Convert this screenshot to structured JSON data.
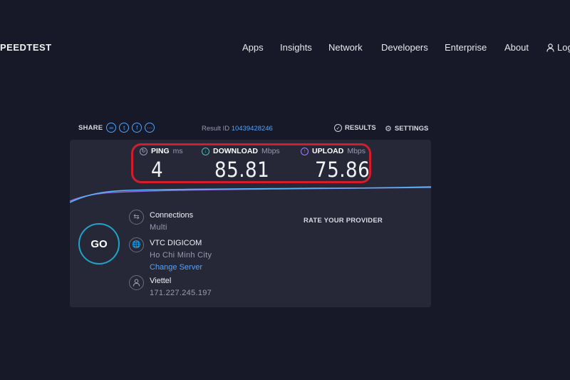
{
  "header": {
    "logo": "PEEDTEST",
    "nav": [
      "Apps",
      "Insights",
      "Network",
      "Developers",
      "Enterprise",
      "About"
    ],
    "login": "Log"
  },
  "toolbar": {
    "share_label": "SHARE",
    "result_id_label": "Result ID",
    "result_id": "10439428246",
    "results_label": "RESULTS",
    "settings_label": "SETTINGS"
  },
  "metrics": {
    "ping": {
      "label": "PING",
      "unit": "ms",
      "value": "4"
    },
    "download": {
      "label": "DOWNLOAD",
      "unit": "Mbps",
      "value": "85.81"
    },
    "upload": {
      "label": "UPLOAD",
      "unit": "Mbps",
      "value": "75.86"
    }
  },
  "go_label": "GO",
  "connections": {
    "label": "Connections",
    "value": "Multi"
  },
  "server": {
    "name": "VTC DIGICOM",
    "city": "Ho Chi Minh City",
    "change": "Change Server"
  },
  "provider": {
    "name": "Viettel",
    "ip": "171.227.245.197"
  },
  "rate_label": "RATE YOUR PROVIDER",
  "colors": {
    "accent": "#4ea5ff",
    "highlight": "#d41c2c",
    "go_ring": "#1fa3c8",
    "download": "#2ad1b8",
    "upload": "#a87bff"
  }
}
